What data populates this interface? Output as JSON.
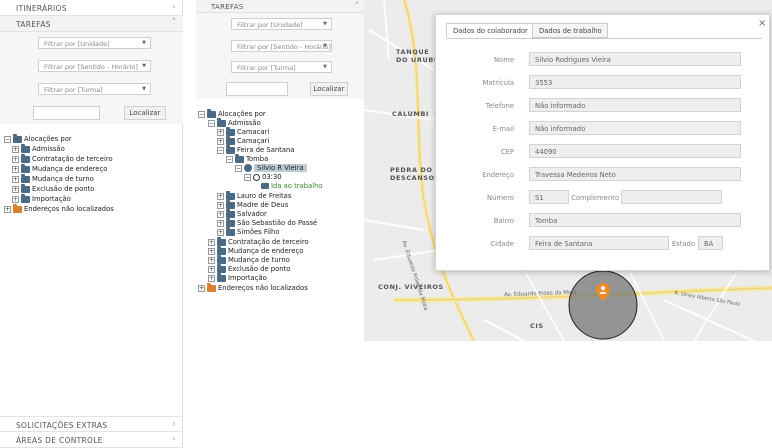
{
  "left_panel": {
    "header_itinerarios": "ITINERÁRIOS",
    "header_tarefas": "TAREFAS",
    "filter_unidade": "Filtrar por [Unidade]",
    "filter_sentido": "Filtrar por [Sentido - Horário]",
    "filter_turma": "Filtrar por [Turma]",
    "localizar": "Localizar",
    "tree": [
      "Alocações por",
      "Admissão",
      "Contratação de terceiro",
      "Mudança de endereço",
      "Mudança de turno",
      "Exclusão de ponto",
      "Importação",
      "Endereços não localizados"
    ],
    "footer_solicitacoes": "SOLICITAÇÕES EXTRAS",
    "footer_areas": "ÁREAS DE CONTROLE"
  },
  "mid_panel": {
    "header_tarefas": "TAREFAS",
    "filter_unidade": "Filtrar por [Unidade]",
    "filter_sentido": "Filtrar por [Sentido - Horário]",
    "filter_turma": "Filtrar por [Turma]",
    "localizar": "Localizar",
    "tree": {
      "root": "Alocações por",
      "admissao": "Admissão",
      "camacari1": "Camacari",
      "camacari2": "Camaçari",
      "feira": "Feira de Santana",
      "tomba": "Tomba",
      "person": "Silvio R Vieira",
      "time": "03:30",
      "trip": "Ida ao trabalho",
      "lauro": "Lauro de Freitas",
      "madre": "Madre de Deus",
      "salvador": "Salvador",
      "sao_sebastiao": "São Sebastião do Passé",
      "simoes": "Simões Filho",
      "contratacao": "Contratação de terceiro",
      "mudanca_end": "Mudança de endereço",
      "mudanca_turno": "Mudança de turno",
      "exclusao": "Exclusão de ponto",
      "importacao": "Importação",
      "nao_localizados": "Endereços não localizados"
    }
  },
  "map": {
    "labels": {
      "tanque": "TANQUE",
      "do_urubu": "DO URUBU",
      "calumbi": "CALUMBI",
      "pedra": "PEDRA DO",
      "descanso": "DESCANSO",
      "conj": "CONJ. VIVEIROS",
      "cis": "CIS",
      "street1": "Av. Eduardo Fróes da Mota",
      "street2": "Av. Eduardo Fróes da Mota",
      "street3": "R. Olney Alberto São Paulo"
    }
  },
  "dialog": {
    "tab_colaborador": "Dados do colaborador",
    "tab_trabalho": "Dados de trabalho",
    "close": "×",
    "labels": {
      "nome": "Nome",
      "matricula": "Matrícula",
      "telefone": "Telefone",
      "email": "E-mail",
      "cep": "CEP",
      "endereco": "Endereço",
      "numero": "Número",
      "complemento": "Complemento",
      "bairro": "Bairro",
      "cidade": "Cidade",
      "estado": "Estado"
    },
    "values": {
      "nome": "Silvio Rodrigues Vieira",
      "matricula": "3553",
      "telefone": "Não informado",
      "email": "Não informado",
      "cep": "44090",
      "endereco": "Travessa Medeiros Neto",
      "numero": "S1",
      "complemento": "",
      "bairro": "Tomba",
      "cidade": "Feira de Santana",
      "estado": "BA"
    }
  },
  "colors": {
    "accent": "#e06b1c",
    "folder": "#4a6b86",
    "marker": "#f08a24"
  }
}
